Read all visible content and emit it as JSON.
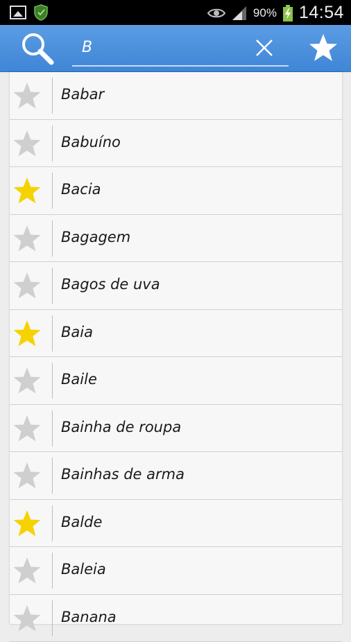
{
  "status_bar": {
    "battery_percent": "90%",
    "time": "14:54",
    "icons": [
      "image-icon",
      "shield-icon",
      "eye-icon",
      "signal-icon",
      "battery-charging-icon"
    ]
  },
  "action_bar": {
    "search_value": "B",
    "icons": [
      "search-icon",
      "clear-icon",
      "favorites-star-icon"
    ]
  },
  "colors": {
    "action_bar": "#4a90dd",
    "star_on": "#f5d300",
    "star_off": "#cfcfcf"
  },
  "words": [
    {
      "label": "Babar",
      "favorite": false
    },
    {
      "label": "Babuíno",
      "favorite": false
    },
    {
      "label": "Bacia",
      "favorite": true
    },
    {
      "label": "Bagagem",
      "favorite": false
    },
    {
      "label": "Bagos de uva",
      "favorite": false
    },
    {
      "label": "Baia",
      "favorite": true
    },
    {
      "label": "Baile",
      "favorite": false
    },
    {
      "label": "Bainha de roupa",
      "favorite": false
    },
    {
      "label": "Bainhas de arma",
      "favorite": false
    },
    {
      "label": "Balde",
      "favorite": true
    },
    {
      "label": "Baleia",
      "favorite": false
    },
    {
      "label": "Banana",
      "favorite": false
    }
  ]
}
